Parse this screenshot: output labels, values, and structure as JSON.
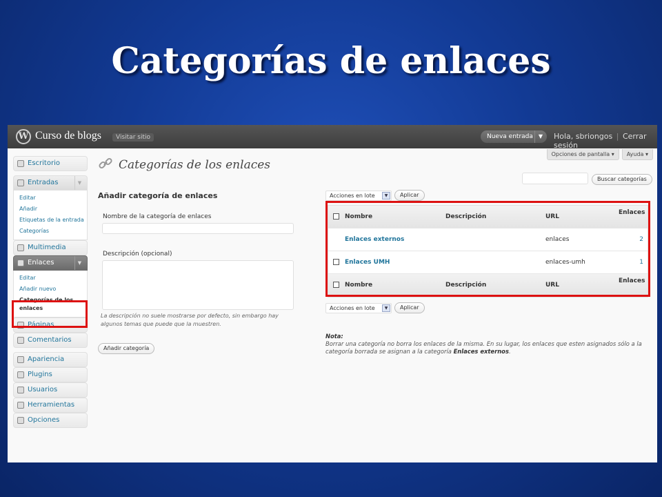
{
  "slide": {
    "title": "Categorías de enlaces"
  },
  "header": {
    "site_title": "Curso de blogs",
    "visit_site": "Visitar sitio",
    "new_post": "Nueva entrada",
    "greeting": "Hola, sbriongos",
    "logout": "Cerrar sesión"
  },
  "screen_meta": {
    "options": "Opciones de pantalla",
    "help": "Ayuda"
  },
  "sidebar": {
    "dashboard": "Escritorio",
    "posts": "Entradas",
    "posts_sub": [
      "Editar",
      "Añadir",
      "Etiquetas de la entrada",
      "Categorías"
    ],
    "media": "Multimedia",
    "links": "Enlaces",
    "links_sub": [
      "Editar",
      "Añadir nuevo",
      "Categorías de los enlaces"
    ],
    "pages": "Páginas",
    "comments": "Comentarios",
    "appearance": "Apariencia",
    "plugins": "Plugins",
    "users": "Usuarios",
    "tools": "Herramientas",
    "settings": "Opciones"
  },
  "main": {
    "page_title": "Categorías de los enlaces",
    "form": {
      "heading": "Añadir categoría de enlaces",
      "name_label": "Nombre de la categoría de enlaces",
      "desc_label": "Descripción (opcional)",
      "hint": "La descripción no suele mostrarse por defecto, sin embargo hay algunos temas que puede que la muestren.",
      "submit": "Añadir categoría"
    },
    "search_button": "Buscar categorías",
    "bulk_actions": "Acciones en lote",
    "apply": "Aplicar",
    "table": {
      "columns": {
        "name": "Nombre",
        "description": "Descripción",
        "url": "URL",
        "count": "Enlaces"
      },
      "rows": [
        {
          "name": "Enlaces externos",
          "description": "",
          "url": "enlaces",
          "count": "2"
        },
        {
          "name": "Enlaces UMH",
          "description": "",
          "url": "enlaces-umh",
          "count": "1"
        }
      ]
    },
    "note": {
      "title": "Nota:",
      "text": "Borrar una categoría no borra los enlaces de la misma. En su lugar, los enlaces que esten asignados sólo a la categoría borrada se asignan a la categoría",
      "default_category": "Enlaces externos",
      "end": "."
    }
  },
  "colors": {
    "highlight": "#dd1111",
    "link": "#21759b",
    "slide_bg": "#123a94"
  }
}
